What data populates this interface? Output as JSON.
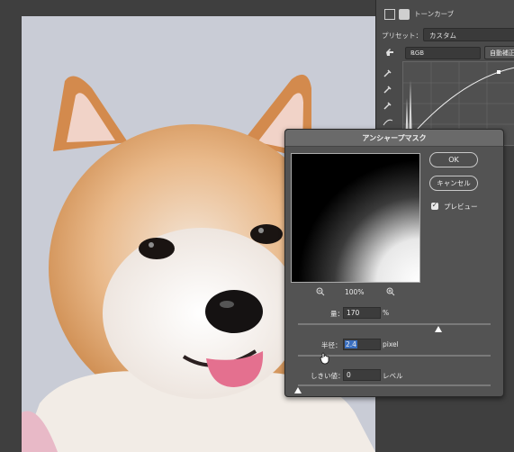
{
  "properties_panel": {
    "tab_title": "トーンカーブ",
    "preset_label": "プリセット：",
    "preset_value": "カスタム",
    "channel_value": "RGB",
    "auto_button": "自動補正"
  },
  "dialog": {
    "title": "アンシャープマスク",
    "ok_label": "OK",
    "cancel_label": "キャンセル",
    "preview_label": "プレビュー",
    "preview_checked": true,
    "zoom_level": "100%",
    "amount_label": "量：",
    "amount_value": "170",
    "amount_unit": "%",
    "radius_label": "半径：",
    "radius_value": "2.4",
    "radius_unit": "pixel",
    "threshold_label": "しきい値：",
    "threshold_value": "0",
    "threshold_unit": "レベル"
  },
  "colors": {
    "dialog_bg": "#535353",
    "titlebar_bg": "#6a6a6a",
    "selection_blue": "#3a6fc0",
    "panel_bg": "#4a4a4a"
  },
  "icons": [
    "curves-adjustment-icon",
    "mask-icon",
    "hand-on-image-icon",
    "eyedropper-black-icon",
    "eyedropper-gray-icon",
    "eyedropper-white-icon",
    "zoom-out-icon",
    "zoom-in-icon",
    "checkbox-icon",
    "pointer-cursor-icon"
  ]
}
